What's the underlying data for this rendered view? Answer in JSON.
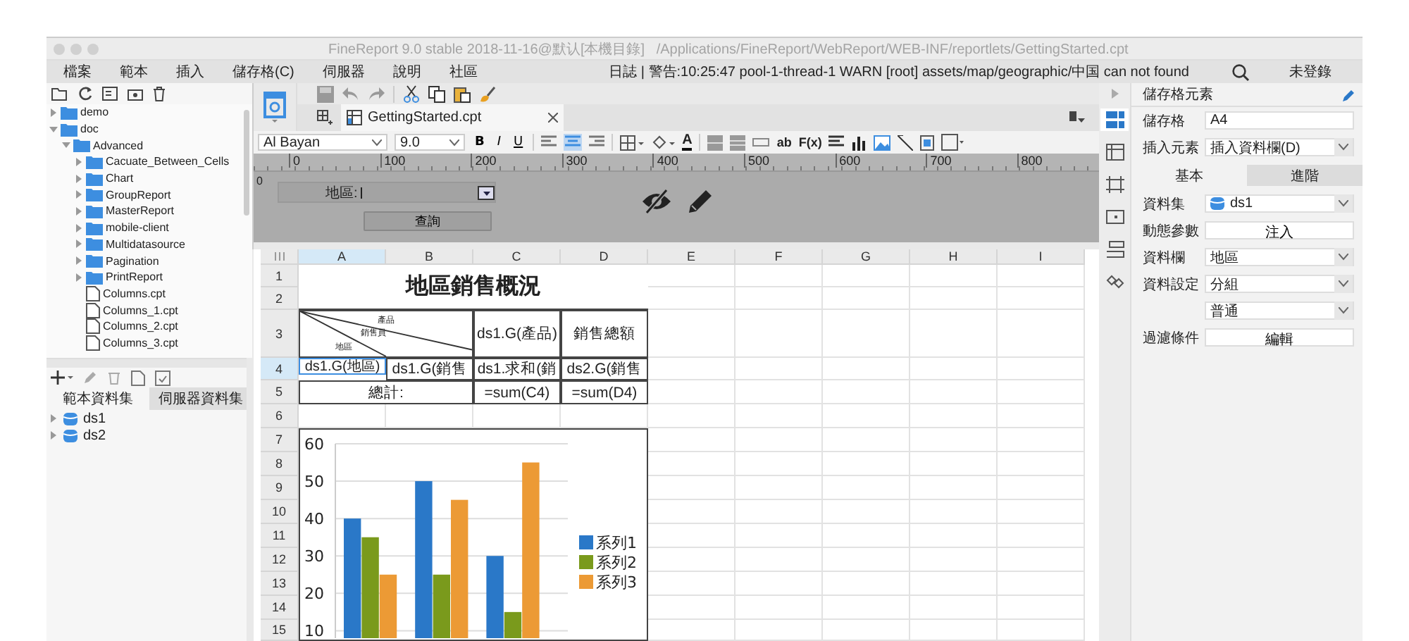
{
  "window": {
    "title": "FineReport 9.0 stable 2018-11-16@默认[本機目錄]   /Applications/FineReport/WebReport/WEB-INF/reportlets/GettingStarted.cpt"
  },
  "menu": [
    "檔案",
    "範本",
    "插入",
    "儲存格(C)",
    "伺服器",
    "說明",
    "社區"
  ],
  "log_message": "日誌 | 警告:10:25:47 pool-1-thread-1 WARN [root] assets/map/geographic/中国 can not found",
  "login": "未登錄",
  "file_tree": [
    {
      "label": "demo",
      "kind": "folder",
      "expanded": false
    },
    {
      "label": "doc",
      "kind": "folder",
      "expanded": true,
      "children": [
        {
          "label": "Advanced",
          "kind": "folder",
          "expanded": true,
          "children": [
            {
              "label": "Cacuate_Between_Cells",
              "kind": "folder",
              "expanded": false
            },
            {
              "label": "Chart",
              "kind": "folder",
              "expanded": false
            },
            {
              "label": "GroupReport",
              "kind": "folder",
              "expanded": false
            },
            {
              "label": "MasterReport",
              "kind": "folder",
              "expanded": false
            },
            {
              "label": "mobile-client",
              "kind": "folder",
              "expanded": false
            },
            {
              "label": "Multidatasource",
              "kind": "folder",
              "expanded": false
            },
            {
              "label": "Pagination",
              "kind": "folder",
              "expanded": false
            },
            {
              "label": "PrintReport",
              "kind": "folder",
              "expanded": false
            },
            {
              "label": "Columns.cpt",
              "kind": "file"
            },
            {
              "label": "Columns_1.cpt",
              "kind": "file"
            },
            {
              "label": "Columns_2.cpt",
              "kind": "file"
            },
            {
              "label": "Columns_3.cpt",
              "kind": "file"
            }
          ]
        }
      ]
    }
  ],
  "dataset_tabs": [
    {
      "label": "範本資料集",
      "selected": true
    },
    {
      "label": "伺服器資料集",
      "selected": false
    }
  ],
  "datasets": [
    "ds1",
    "ds2"
  ],
  "document_tab": "GettingStarted.cpt",
  "format_toolbar": {
    "font": "Al Bayan",
    "size": "9.0",
    "style_buttons": [
      "B",
      "I",
      "U"
    ],
    "font_color_button": "A",
    "text_buttons": [
      "ab",
      "F(x)"
    ]
  },
  "ruler": [
    "0",
    "100",
    "200",
    "300",
    "400",
    "500",
    "600",
    "700",
    "800"
  ],
  "vertical_ruler": "0",
  "parameter_form": {
    "label": "地區:",
    "button": "查詢"
  },
  "sheet": {
    "columns": [
      "A",
      "B",
      "C",
      "D",
      "E",
      "F",
      "G",
      "H",
      "I"
    ],
    "rows": [
      "1",
      "2",
      "3",
      "4",
      "5",
      "6",
      "7",
      "8",
      "9",
      "10",
      "11",
      "12",
      "13",
      "14",
      "15"
    ],
    "cells": [
      {
        "kind": "title",
        "text": "地區銷售概況",
        "selected": false
      },
      {
        "kind": "diagonal",
        "labels": [
          "產品",
          "銷售員",
          "地區"
        ],
        "selected": false
      },
      {
        "kind": "text",
        "text": "ds1.G(產品)",
        "selected": false
      },
      {
        "kind": "text",
        "text": "銷售總額",
        "selected": false
      },
      {
        "kind": "text",
        "text": "ds1.G(地區)",
        "selected": true
      },
      {
        "kind": "text",
        "text": "ds1.G(銷售",
        "selected": false
      },
      {
        "kind": "text",
        "text": "ds1.求和(銷",
        "selected": false
      },
      {
        "kind": "text",
        "text": "ds2.G(銷售",
        "selected": false
      },
      {
        "kind": "text",
        "text": "總計:",
        "selected": false
      },
      {
        "kind": "text",
        "text": "=sum(C4)",
        "selected": false
      },
      {
        "kind": "text",
        "text": "=sum(D4)",
        "selected": false
      }
    ],
    "chart": {
      "chart_data": {
        "type": "bar",
        "ylim": [
          8,
          60
        ],
        "grid": true,
        "legend": true,
        "yticks": [
          10,
          20,
          30,
          40,
          50,
          60
        ],
        "series": [
          {
            "name": "系列1",
            "color": "#2a78c8",
            "values": [
              40,
              50,
              30
            ]
          },
          {
            "name": "系列2",
            "color": "#7a9a1c",
            "values": [
              35,
              25,
              15
            ]
          },
          {
            "name": "系列3",
            "color": "#ec9a35",
            "values": [
              25,
              45,
              55
            ]
          }
        ]
      }
    }
  },
  "property_panes": [
    {
      "kind": "cell",
      "selected": true
    },
    {
      "kind": "attributes",
      "selected": false
    },
    {
      "kind": "border",
      "selected": false
    },
    {
      "kind": "widget",
      "selected": false
    },
    {
      "kind": "condition",
      "selected": false
    },
    {
      "kind": "hyperlink",
      "selected": false
    }
  ],
  "properties": {
    "title": "儲存格元素",
    "cell_label": "儲存格",
    "cell": "A4",
    "insert_label": "插入元素",
    "insert_element": "插入資料欄(D)",
    "tabs": [
      {
        "label": "基本",
        "selected": true
      },
      {
        "label": "進階",
        "selected": false
      }
    ],
    "rows": [
      {
        "label": "資料集",
        "kind": "dataset-select",
        "value": "ds1"
      },
      {
        "label": "動態參數",
        "kind": "button",
        "value": "注入"
      },
      {
        "label": "資料欄",
        "kind": "select",
        "value": "地區"
      },
      {
        "label": "資料設定",
        "kind": "select",
        "value": "分組"
      },
      {
        "kind": "select",
        "value": "普通"
      },
      {
        "label": "過濾條件",
        "kind": "button",
        "value": "編輯"
      }
    ]
  }
}
